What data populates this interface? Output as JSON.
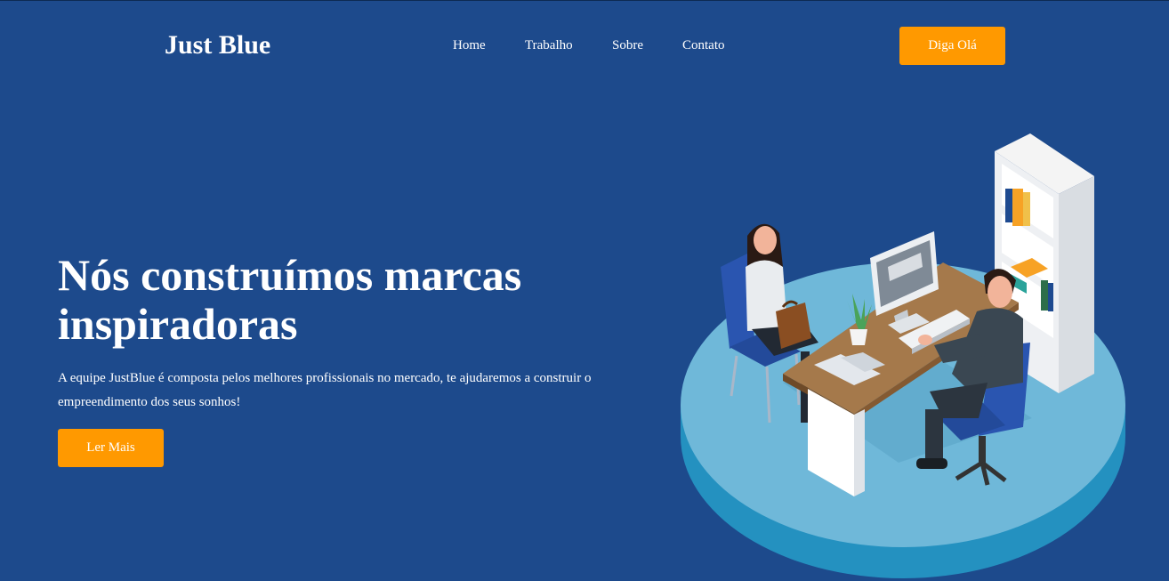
{
  "header": {
    "logo": "Just Blue",
    "nav": [
      "Home",
      "Trabalho",
      "Sobre",
      "Contato"
    ],
    "cta_label": "Diga Olá"
  },
  "hero": {
    "title": "Nós construímos marcas inspiradoras",
    "description": "A equipe JustBlue é composta pelos melhores profissionais no mercado, te ajudaremos a construir o empreendimento dos seus sonhos!",
    "cta_label": "Ler Mais"
  },
  "colors": {
    "background": "#1d4a8c",
    "accent": "#ff9900",
    "platform": "#6fb8d9"
  },
  "illustration": {
    "icon": "office-meeting-illustration"
  }
}
